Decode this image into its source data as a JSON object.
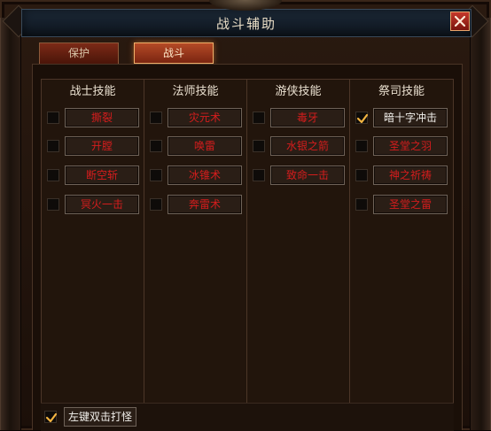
{
  "window": {
    "title": "战斗辅助",
    "close_icon": "close-icon"
  },
  "tabs": [
    {
      "label": "保护",
      "active": false
    },
    {
      "label": "战斗",
      "active": true
    }
  ],
  "columns": [
    {
      "header": "战士技能",
      "skills": [
        {
          "name": "撕裂",
          "checked": false
        },
        {
          "name": "开膛",
          "checked": false
        },
        {
          "name": "断空斩",
          "checked": false
        },
        {
          "name": "冥火一击",
          "checked": false
        }
      ]
    },
    {
      "header": "法师技能",
      "skills": [
        {
          "name": "灾元术",
          "checked": false
        },
        {
          "name": "唤雷",
          "checked": false
        },
        {
          "name": "冰锥术",
          "checked": false
        },
        {
          "name": "奔雷术",
          "checked": false
        }
      ]
    },
    {
      "header": "游侠技能",
      "skills": [
        {
          "name": "毒牙",
          "checked": false
        },
        {
          "name": "水银之箭",
          "checked": false
        },
        {
          "name": "致命一击",
          "checked": false
        }
      ]
    },
    {
      "header": "祭司技能",
      "skills": [
        {
          "name": "暗十字冲击",
          "checked": true
        },
        {
          "name": "圣堂之羽",
          "checked": false
        },
        {
          "name": "神之祈祷",
          "checked": false
        },
        {
          "name": "圣堂之雷",
          "checked": false
        }
      ]
    }
  ],
  "options": {
    "left_double_click_label": "左键双击打怪",
    "left_double_click_checked": true
  },
  "colors": {
    "inactive_skill_text": "#d51d1d",
    "active_skill_text": "#f2f0ec",
    "check_color": "#f3b441"
  }
}
